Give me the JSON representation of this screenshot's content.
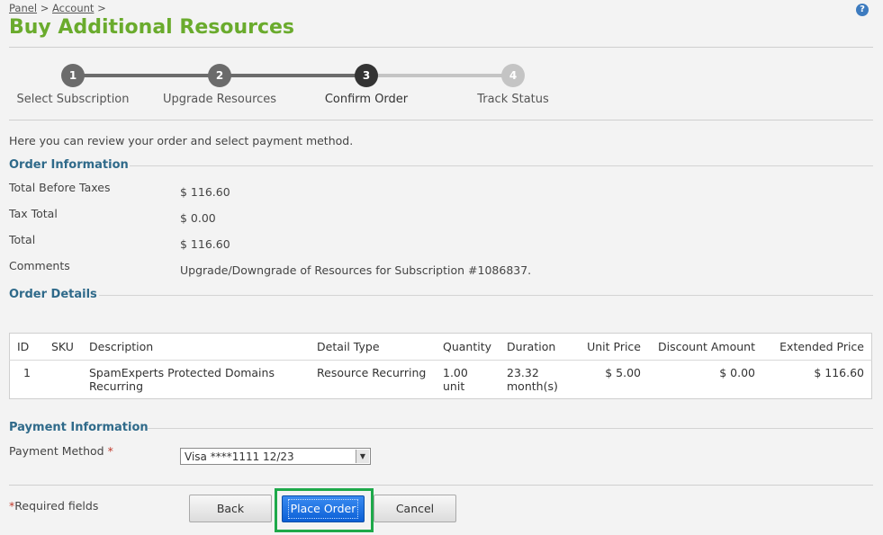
{
  "breadcrumb": {
    "panel": "Panel",
    "sep1": ">",
    "account": "Account",
    "sep2": ">"
  },
  "help_label": "?",
  "page_title": "Buy Additional Resources",
  "steps": [
    {
      "number": "1",
      "label": "Select Subscription",
      "state": "done"
    },
    {
      "number": "2",
      "label": "Upgrade Resources",
      "state": "done"
    },
    {
      "number": "3",
      "label": "Confirm Order",
      "state": "current"
    },
    {
      "number": "4",
      "label": "Track Status",
      "state": "pending"
    }
  ],
  "intro": "Here you can review your order and select payment method.",
  "order_info": {
    "title": "Order Information",
    "rows": [
      {
        "label": "Total Before Taxes",
        "value": "$ 116.60"
      },
      {
        "label": "Tax Total",
        "value": "$ 0.00"
      },
      {
        "label": "Total",
        "value": "$ 116.60"
      },
      {
        "label": "Comments",
        "value": "Upgrade/Downgrade of Resources for Subscription #1086837."
      }
    ]
  },
  "order_details": {
    "title": "Order Details",
    "columns": [
      "ID",
      "SKU",
      "Description",
      "Detail Type",
      "Quantity",
      "Duration",
      "Unit Price",
      "Discount Amount",
      "Extended Price"
    ],
    "rows": [
      {
        "id": "1",
        "sku": "",
        "description_line1": "SpamExperts Protected Domains",
        "description_line2": "Recurring",
        "detail_type": "Resource Recurring",
        "quantity": "1.00 unit",
        "duration_line1": "23.32",
        "duration_line2": "month(s)",
        "unit_price": "$ 5.00",
        "discount_amount": "$ 0.00",
        "extended_price": "$ 116.60"
      }
    ]
  },
  "payment": {
    "title": "Payment Information",
    "method_label": "Payment Method",
    "required_mark": "*",
    "method_value": "Visa ****1111 12/23"
  },
  "footer": {
    "required_mark": "*",
    "required_text": "Required fields",
    "back_label": "Back",
    "place_order_label": "Place Order",
    "cancel_label": "Cancel"
  },
  "colors": {
    "title_green": "#6aab2d",
    "section_blue": "#2f6a8a",
    "step_done": "#6b6b6b",
    "step_current": "#333333",
    "step_pending": "#c4c4c4",
    "primary_blue": "#0b5fd6",
    "focus_green": "#1ea94a"
  }
}
